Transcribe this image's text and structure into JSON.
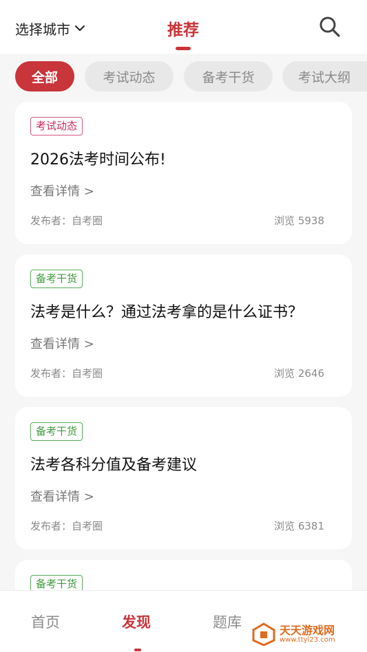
{
  "header": {
    "city_label": "选择城市",
    "title": "推荐"
  },
  "chips": [
    {
      "label": "全部",
      "active": true
    },
    {
      "label": "考试动态",
      "active": false
    },
    {
      "label": "备考干货",
      "active": false
    },
    {
      "label": "考试大纲",
      "active": false
    }
  ],
  "cards": [
    {
      "tag": "考试动态",
      "tag_color": "#c82a5a",
      "title": "2026法考时间公布!",
      "link": "查看详情 >",
      "publisher": "发布者：自考圈",
      "views": "浏览 5938"
    },
    {
      "tag": "备考干货",
      "tag_color": "#3d9a3d",
      "title": "法考是什么？通过法考拿的是什么证书？",
      "link": "查看详情 >",
      "publisher": "发布者：自考圈",
      "views": "浏览 2646"
    },
    {
      "tag": "备考干货",
      "tag_color": "#3d9a3d",
      "title": "法考各科分值及备考建议",
      "link": "查看详情 >",
      "publisher": "发布者：自考圈",
      "views": "浏览 6381"
    },
    {
      "tag": "备考干货",
      "tag_color": "#3d9a3d"
    }
  ],
  "bottom_nav": [
    {
      "label": "首页",
      "active": false
    },
    {
      "label": "发现",
      "active": true
    },
    {
      "label": "题库",
      "active": false
    }
  ],
  "watermark": {
    "main": "天天游戏网",
    "sub": "www.ttyl23.com"
  },
  "colors": {
    "accent": "#c8353a",
    "background": "#f6f6f6"
  }
}
